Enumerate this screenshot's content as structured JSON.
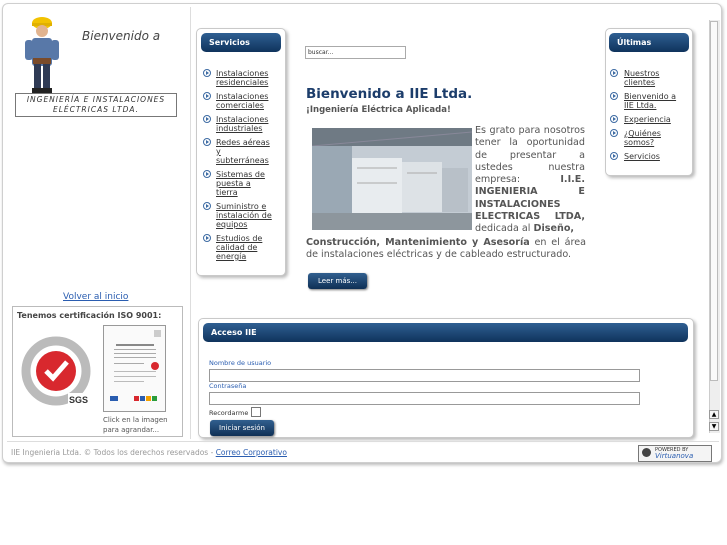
{
  "header": {
    "welcome_small": "Bienvenido a",
    "logo_line1": "INGENIERÍA E INSTALACIONES",
    "logo_line2": "ELÉCTRICAS LTDA."
  },
  "sidebar_left": {
    "back_link": "Volver al inicio",
    "iso_title": "Tenemos certificación ISO 9001:",
    "iso_click": "Click en la imagen para agrandar..."
  },
  "servicios": {
    "title": "Servicios",
    "items": [
      {
        "label": "Instalaciones residenciales"
      },
      {
        "label": "Instalaciones comerciales"
      },
      {
        "label": "Instalaciones industriales"
      },
      {
        "label": "Redes aéreas y subterráneas"
      },
      {
        "label": "Sistemas de puesta a tierra"
      },
      {
        "label": "Suministro e instalación de equipos"
      },
      {
        "label": "Estudios de calidad de energía"
      }
    ]
  },
  "search": {
    "placeholder": "buscar..."
  },
  "main": {
    "title": "Bienvenido a IIE Ltda.",
    "subtitle": "¡Ingeniería Eléctrica Aplicada!",
    "text_intro": "Es grato para nosotros tener la oportunidad de presentar a ustedes nuestra empresa: ",
    "company_name": "I.I.E. INGENIERIA E INSTALACIONES ELECTRICAS LTDA,",
    "text_dedicada": " dedicada al ",
    "diseno": "Diseño,",
    "services_bold": "Construcción, Mantenimiento y Asesoría",
    "text_end": " en el área de instalaciones eléctricas y de cableado estructurado.",
    "read_more": "Leer más..."
  },
  "news": {
    "title": "Últimas noticias",
    "items": [
      {
        "label": "Nuestros clientes"
      },
      {
        "label": "Bienvenido a IIE Ltda."
      },
      {
        "label": "Experiencia"
      },
      {
        "label": "¿Quiénes somos?"
      },
      {
        "label": "Servicios"
      }
    ]
  },
  "login": {
    "title": "Acceso IIE",
    "username_label": "Nombre de usuario",
    "password_label": "Contraseña",
    "remember_label": "Recordarme",
    "submit_label": "Iniciar sesión"
  },
  "footer": {
    "copyright": "IIE Ingenieria Ltda. © Todos los derechos reservados - ",
    "link": "Correo Corporativo",
    "powered_by": "POWERED BY",
    "powered_brand": "Virtuanova"
  },
  "colors": {
    "accent": "#1c3d6b",
    "panel_header": "#14375f",
    "link": "#2a5db0"
  }
}
